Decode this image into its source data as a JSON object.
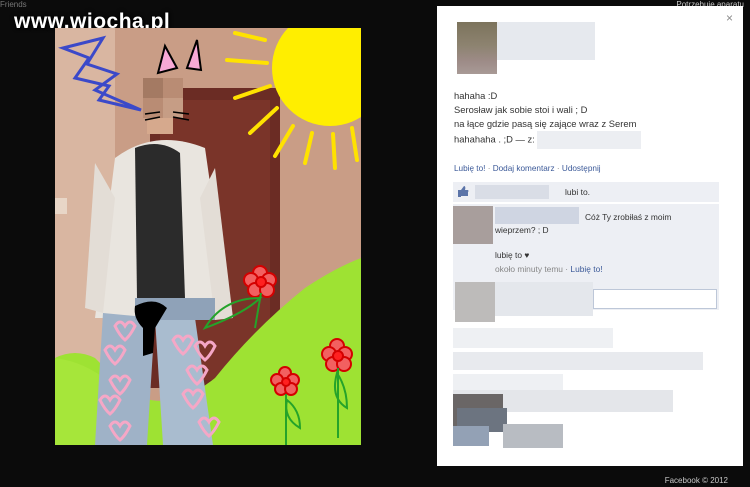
{
  "background": {
    "color": "#0b0b0b"
  },
  "watermark": {
    "text": "www.wiocha.pl"
  },
  "page_fragments": {
    "top_left": "Friends",
    "top_right": "Potrzebuje aparatu",
    "bottom_right": "Facebook © 2012"
  },
  "photo": {
    "description_icons": [
      "lightning-icon",
      "cat-ears-icon",
      "sun-icon",
      "flower-icon",
      "heart-icon",
      "leaf-icon"
    ],
    "colors": {
      "sky_wall": "#c79a83",
      "grass": "#9ee233",
      "sun": "#ffee00",
      "hearts": "#f5a7c6",
      "lightning": "#3b49c9"
    }
  },
  "panel": {
    "close_label": "×",
    "post_lines": [
      "hahaha :D",
      "Serosław jak sobie stoi i wali ; D",
      "na łące gdzie pasą się zające wraz z Serem",
      "hahahaha . ;D — z:"
    ],
    "actions": {
      "like": "Lubię to!",
      "sep": "·",
      "comment": "Dodaj komentarz",
      "share": "Udostępnij"
    },
    "likes_text": "lubi to.",
    "comment": {
      "line1": "Cóż Ty zrobiłaś z moim",
      "line2": "wieprzem? ; D",
      "likes_line": "lubię to ♥",
      "time": "około minuty temu",
      "meta_sep": "·",
      "like_link": "Lubię to!"
    }
  },
  "accent_colors": {
    "link": "#3b5998",
    "comment_bg": "#edeff4",
    "input_border": "#bdc7d8"
  }
}
